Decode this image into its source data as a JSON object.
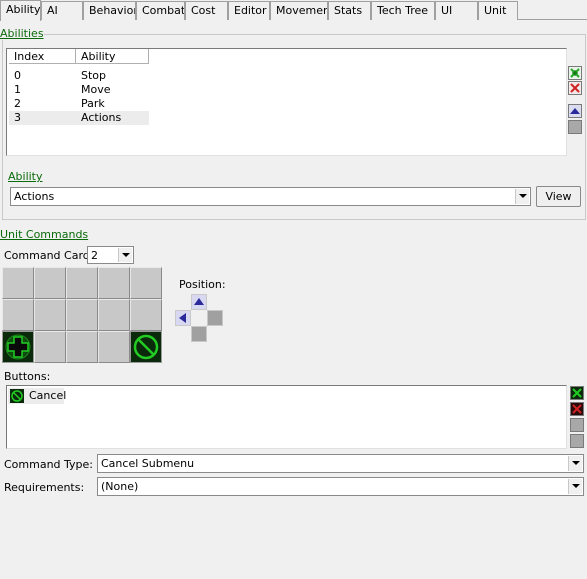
{
  "tabs": [
    {
      "label": "Ability",
      "active": true
    },
    {
      "label": "AI",
      "active": false
    },
    {
      "label": "Behavior",
      "active": false
    },
    {
      "label": "Combat",
      "active": false
    },
    {
      "label": "Cost",
      "active": false
    },
    {
      "label": "Editor",
      "active": false
    },
    {
      "label": "Movement",
      "active": false
    },
    {
      "label": "Stats",
      "active": false
    },
    {
      "label": "Tech Tree",
      "active": false
    },
    {
      "label": "UI",
      "active": false
    },
    {
      "label": "Unit",
      "active": false
    }
  ],
  "abilities": {
    "group_label": "Abilities",
    "columns": [
      "Index",
      "Ability"
    ],
    "rows": [
      {
        "index": "0",
        "ability": "Stop"
      },
      {
        "index": "1",
        "ability": "Move"
      },
      {
        "index": "2",
        "ability": "Park"
      },
      {
        "index": "3",
        "ability": "Actions",
        "selected": true
      }
    ],
    "buttons": [
      "add-icon",
      "remove-icon",
      "move-up-icon",
      "move-down-icon"
    ]
  },
  "ability": {
    "label": "Ability",
    "value": "Actions",
    "view_button": "View"
  },
  "unit_commands": {
    "group_label": "Unit Commands",
    "command_card_label": "Command Card:",
    "command_card_value": "2",
    "position_label": "Position:",
    "buttons_label": "Buttons:",
    "buttons_list": [
      {
        "label": "Cancel",
        "icon": "cancel-icon"
      }
    ],
    "command_type_label": "Command Type:",
    "command_type_value": "Cancel Submenu",
    "requirements_label": "Requirements:",
    "requirements_value": "(None)"
  },
  "colors": {
    "group_label": "#0a6a0a",
    "icon_green": "#22cc22",
    "icon_red": "#cc2222",
    "icon_blue": "#2a2a9a"
  }
}
